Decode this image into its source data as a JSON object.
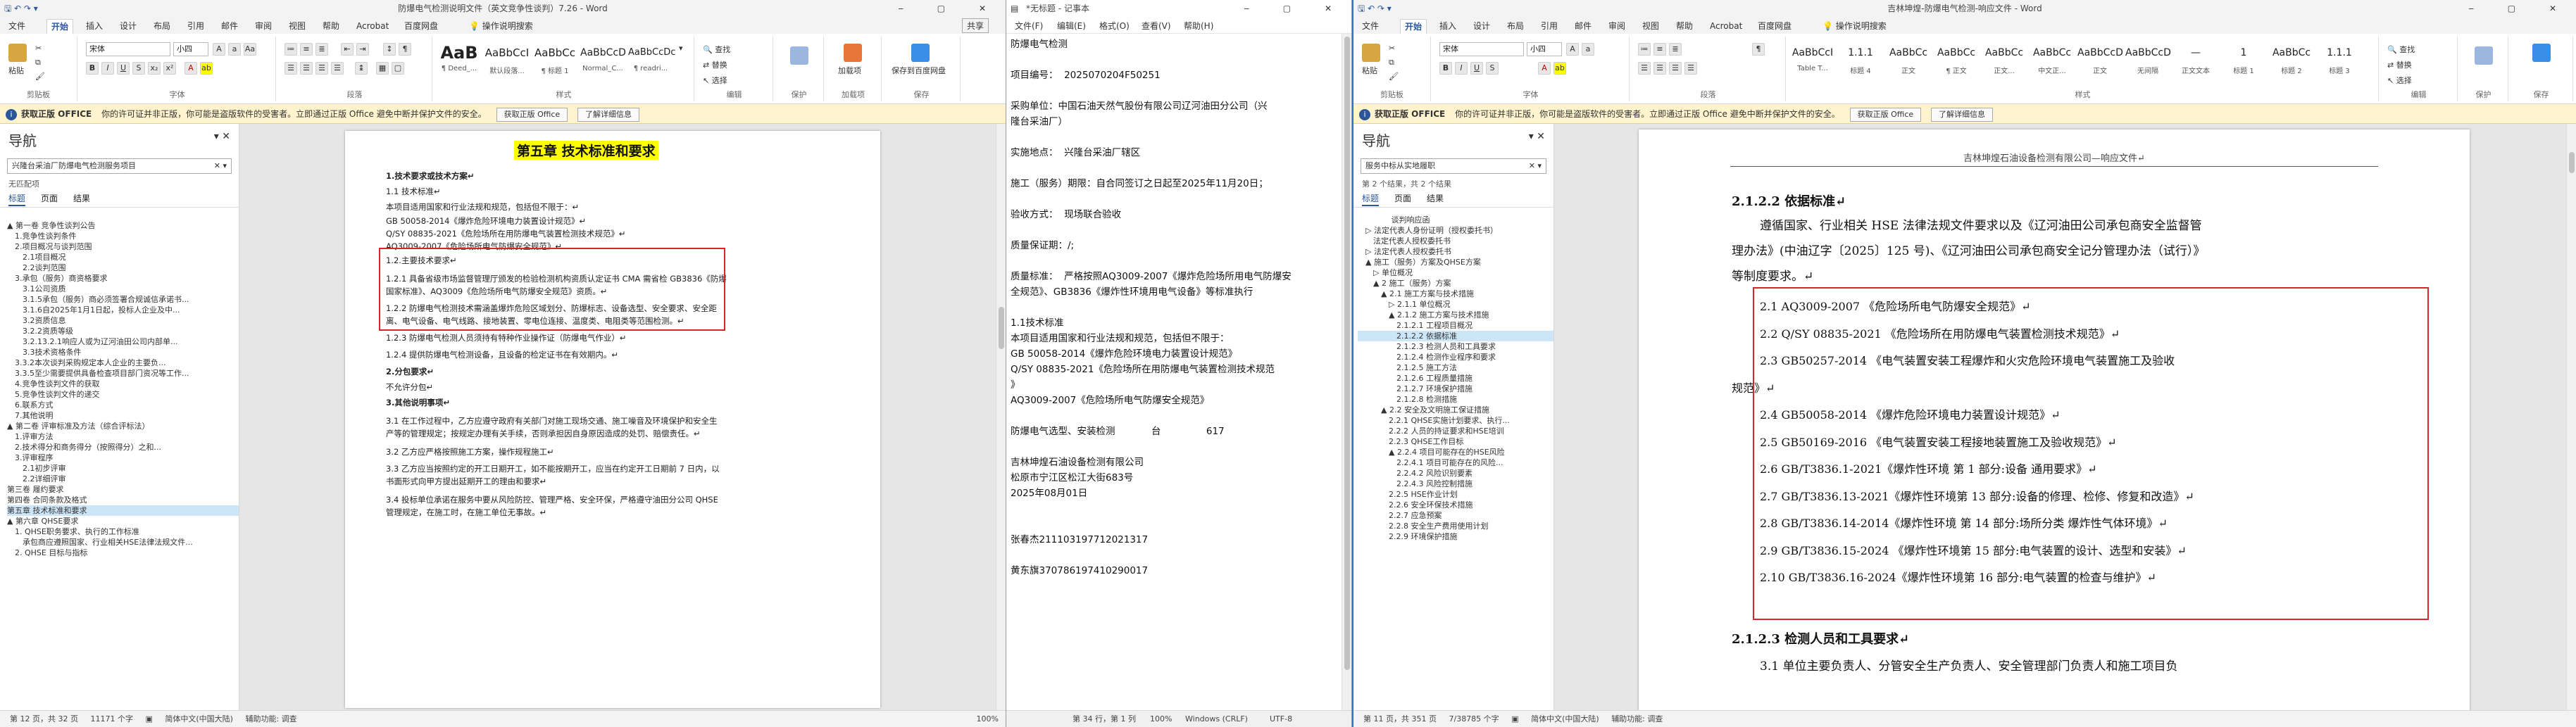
{
  "w1": {
    "title": "防爆电气检测说明文件（英文竞争性谈判）7.26 - Word",
    "menu": [
      "文件",
      "开始",
      "插入",
      "设计",
      "布局",
      "引用",
      "邮件",
      "审阅",
      "视图",
      "帮助",
      "Acrobat",
      "百度网盘",
      "操作说明搜索"
    ],
    "share": "共享",
    "font_name": "宋体",
    "font_size": "小四",
    "clipboard": "剪贴板",
    "font_group": "字体",
    "para_group": "段落",
    "style_group": "样式",
    "edit_group": "编辑",
    "protect_group": "保护",
    "addin_group": "加载项",
    "save_group": "保存",
    "paste": "粘贴",
    "find": "查找",
    "replace": "替换",
    "select": "选择",
    "addin": "加载项",
    "save_to": "保存到百度网盘",
    "styles": [
      {
        "p": "AaB",
        "n": "¶ Deed_..."
      },
      {
        "p": "AaBbCcI",
        "n": "默认段落..."
      },
      {
        "p": "AaBbCc",
        "n": "¶ 标题 1"
      },
      {
        "p": "AaBbCcD",
        "n": "Normal_C..."
      },
      {
        "p": "AaBbCcDc",
        "n": "¶ readri..."
      }
    ],
    "info": {
      "label": "获取正版 OFFICE",
      "text": "你的许可证并非正版，你可能是盗版软件的受害者。立即通过正版 Office 避免中断并保护文件的安全。",
      "btn1": "获取正版 Office",
      "btn2": "了解详细信息"
    },
    "nav": {
      "title": "导航",
      "search": "兴隆台采油厂防爆电气检测服务项目",
      "sub": "无匹配项",
      "tabs": [
        "标题",
        "页面",
        "结果"
      ],
      "items": [
        "▲ 第一卷 竞争性谈判公告",
        "　1.竞争性谈判条件",
        "　2.项目概况与谈判范围",
        "　　2.1项目概况",
        "　　2.2谈判范围",
        "　3.承包（服务）商资格要求",
        "　　3.1公司资质",
        "　　3.1.5承包（服务）商必须签署合规诚信承诺书...",
        "　　3.1.6自2025年1月1日起，投标人企业及中...",
        "　　3.2资质信息",
        "　　3.2.2资质等级",
        "　　3.2.13.2.1响应人或为辽河油田公司内部单...",
        "　　3.3技术资格条件",
        "　3.3.2本次谈判采购规定本人企业的主要负...",
        "　3.3.5至少需要提供具备检查项目部门资况等工作...",
        "　4.竞争性谈判文件的获取",
        "　5.竞争性谈判文件的递交",
        "　6.联系方式",
        "　7.其他说明",
        "▲ 第二卷 评审标准及方法（综合评标法）",
        "　1.评审方法",
        "　2.技术得分和商务得分（按照得分）之和...",
        "　3.评审程序",
        "　　2.1初步评审",
        "　　2.2详细评审",
        "第三卷 履约要求",
        "第四卷 合同条款及格式",
        "第五章 技术标准和要求",
        "▲ 第六章 QHSE要求",
        "　1. QHSE职务要求、执行的工作标准",
        "　　承包商应遵照国家、行业相关HSE法律法规文件...",
        "　2. QHSE 目标与指标"
      ],
      "selected": 27
    },
    "doc": {
      "heading": "第五章  技术标准和要求",
      "lines": [
        "1.技术要求或技术方案↵",
        "1.1 技术标准↵",
        "本项目适用国家和行业法规和规范，包括但不限于：↵",
        "GB 50058-2014《爆炸危险环境电力装置设计规范》↵",
        "Q/SY 08835-2021《危险场所在用防爆电气装置检测技术规范》↵",
        "AQ3009-2007《危险场所电气防爆安全规范》↵",
        "1.2.主要技术要求↵",
        "1.2.1 具备省级市场监督管理厅颁发的检验检测机构资质认定证书 CMA 需省检 GB3836《防爆",
        "国家标准》、AQ3009《危险场所电气防爆安全规范》资质。↵",
        "1.2.2 防爆电气检测技术需涵盖爆炸危险区域划分、防爆标志、设备选型、安全要求、安全距",
        "离、电气设备、电气线路、接地装置、零电位连接、温度类、电阻类等范围检测。↵",
        "1.2.3 防爆电气检测人员须持有特种作业操作证（防爆电气作业）↵",
        "1.2.4 提供防爆电气检测设备，且设备的检定证书在有效期内。↵",
        "2.分包要求↵",
        "不允许分包↵",
        "3.其他说明事项↵",
        "3.1 在工作过程中，乙方应遵守政府有关部门对施工现场交通、施工噪音及环境保护和安全生",
        "产等的管理规定；按规定办理有关手续，否则承担因自身原因造成的处罚、赔偿责任。↵",
        "3.2 乙方应严格按照施工方案，操作规程施工↵",
        "3.3 乙方应当按照约定的开工日期开工，如不能按期开工，应当在约定开工日期前 7 日内，以",
        "书面形式向甲方提出延期开工的理由和要求↵",
        "3.4 投标单位承诺在服务中要从风险防控、管理严格、安全环保，严格遵守油田分公司 QHSE",
        "管理规定，在施工时，在施工单位无事故。↵"
      ]
    },
    "status": {
      "page": "第 12 页，共 32 页",
      "words": "11171 个字",
      "lang": "简体中文(中国大陆)",
      "aux": "辅助功能: 调查",
      "zoom": "100%"
    }
  },
  "w2": {
    "title": "*无标题 - 记事本",
    "menu": [
      "文件(F)",
      "编辑(E)",
      "格式(O)",
      "查看(V)",
      "帮助(H)"
    ],
    "lines": [
      "防爆电气检测",
      "",
      "项目编号：  2025070204F50251",
      "",
      "采购单位：中国石油天然气股份有限公司辽河油田分公司（兴",
      "隆台采油厂）",
      "",
      "实施地点：  兴隆台采油厂辖区",
      "",
      "施工（服务）期限：自合同签订之日起至2025年11月20日；",
      "",
      "验收方式：  现场联合验收",
      "",
      "质量保证期：/;",
      "",
      "质量标准：  严格按照AQ3009-2007《爆炸危险场所用电气防爆安",
      "全规范》、GB3836《爆炸性环境用电气设备》等标准执行",
      "",
      "1.1技术标准",
      "本项目适用国家和行业法规和规范，包括但不限于：",
      "GB 50058-2014《爆炸危险环境电力装置设计规范》",
      "Q/SY 08835-2021《危险场所在用防爆电气装置检测技术规范",
      "》",
      "AQ3009-2007《危险场所电气防爆安全规范》",
      "",
      "防爆电气选型、安装检测            台               617",
      "",
      "吉林坤煌石油设备检测有限公司",
      "松原市宁江区松江大街683号",
      "2025年08月01日",
      "",
      "",
      "张春杰211103197712021317",
      "",
      "黄东旗370786197410290017"
    ],
    "status": {
      "pos": "第 34 行，第 1 列",
      "zoom": "100%",
      "eol": "Windows (CRLF)",
      "enc": "UTF-8"
    }
  },
  "w3": {
    "title": "吉林坤煌-防爆电气检测-响应文件 - Word",
    "menu": [
      "文件",
      "开始",
      "插入",
      "设计",
      "布局",
      "引用",
      "邮件",
      "审阅",
      "视图",
      "帮助",
      "Acrobat",
      "百度网盘",
      "操作说明搜索"
    ],
    "font_name": "宋体",
    "font_size": "小四",
    "styles": [
      {
        "p": "AaBbCcI",
        "n": "Table T..."
      },
      {
        "p": "1.1.1",
        "n": "标题 4"
      },
      {
        "p": "AaBbCc",
        "n": "正文"
      },
      {
        "p": "AaBbCc",
        "n": "¶ 正文"
      },
      {
        "p": "AaBbCc",
        "n": "正文..."
      },
      {
        "p": "AaBbCc",
        "n": "中文正..."
      },
      {
        "p": "AaBbCcD",
        "n": "正文"
      },
      {
        "p": "AaBbCcD",
        "n": "无间隔"
      },
      {
        "p": "—",
        "n": "正文文本"
      },
      {
        "p": "1",
        "n": "标题 1"
      },
      {
        "p": "AaBbCc",
        "n": "标题 2"
      },
      {
        "p": "1.1.1",
        "n": "标题 3"
      }
    ],
    "info": {
      "label": "获取正版 OFFICE",
      "text": "你的许可证并非正版，你可能是盗版软件的受害者。立即通过正版 Office 避免中断并保护文件的安全。",
      "btn1": "获取正版 Office",
      "btn2": "了解详细信息"
    },
    "nav": {
      "title": "导航",
      "search": "服务中标从实地履职",
      "sub": "第 2 个结果，共 2 个结果",
      "tabs": [
        "标题",
        "页面",
        "结果"
      ],
      "items": [
        "　　　　 谈判响应函",
        "　▷ 法定代表人身份证明（授权委托书）",
        "　　法定代表人授权委托书",
        "　▷ 法定代表人授权委托书",
        "　▲ 施工（服务）方案及QHSE方案",
        "　　▷ 单位概况",
        "　　▲ 2 施工（服务）方案",
        "　　　▲ 2.1 施工方案与技术措施",
        "　　　　▷ 2.1.1 单位概况",
        "　　　　▲ 2.1.2 施工方案与技术措施",
        "　　　　　2.1.2.1 工程项目概况",
        "　　　　　2.1.2.2 依据标准",
        "　　　　　2.1.2.3 检测人员和工具要求",
        "　　　　　2.1.2.4 检测作业程序和要求",
        "　　　　　2.1.2.5 施工方法",
        "　　　　　2.1.2.6 工程质量措施",
        "　　　　　2.1.2.7 环境保护措施",
        "　　　　　2.1.2.8 检测措施",
        "　　　▲ 2.2 安全及文明施工保证措施",
        "　　　　2.2.1 QHSE实施计划要求、执行...",
        "　　　　2.2.2 人员的持证要求和HSE培训",
        "　　　　2.2.3 QHSE工作目标",
        "　　　　▲ 2.2.4 项目可能存在的HSE风险",
        "　　　　　2.2.4.1 项目可能存在的风险...",
        "　　　　　2.2.4.2 风险识别要素",
        "　　　　　2.2.4.3 风险控制措施",
        "　　　　2.2.5 HSE作业计划",
        "　　　　2.2.6 安全环保技术措施",
        "　　　　2.2.7 应急预案",
        "　　　　2.2.8 安全生产费用使用计划",
        "　　　　2.2.9 环境保护措施"
      ],
      "selected": 11
    },
    "doc": {
      "header": "吉林坤煌石油设备检测有限公司—响应文件↵",
      "h1": "2.1.2.2    依据标准↵",
      "intro": [
        "遵循国家、行业相关 HSE 法律法规文件要求以及《辽河油田公司承包商安全监督管",
        "理办法》(中油辽字〔2025〕125 号)、《辽河油田公司承包商安全记分管理办法（试行）》",
        "等制度要求。↵"
      ],
      "items": [
        "2.1 AQ3009-2007 《危险场所电气防爆安全规范》↵",
        "2.2 Q/SY 08835-2021 《危险场所在用防爆电气装置检测技术规范》↵",
        "2.3 GB50257-2014 《电气装置安装工程爆炸和火灾危险环境电气装置施工及验收",
        "规范》↵",
        "2.4 GB50058-2014 《爆炸危险环境电力装置设计规范》↵",
        "2.5 GB50169-2016 《电气装置安装工程接地装置施工及验收规范》↵",
        "2.6 GB/T3836.1-2021《爆炸性环境 第 1 部分:设备 通用要求》↵",
        "2.7 GB/T3836.13-2021《爆炸性环境第 13 部分:设备的修理、检修、修复和改造》↵",
        "2.8 GB/T3836.14-2014《爆炸性环境 第 14 部分:场所分类 爆炸性气体环境》↵",
        "2.9 GB/T3836.15-2024 《爆炸性环境第 15 部分:电气装置的设计、选型和安装》↵",
        "2.10 GB/T3836.16-2024《爆炸性环境第 16 部分:电气装置的检查与维护》↵"
      ],
      "h2": "2.1.2.3    检测人员和工具要求↵",
      "tail": "3.1 单位主要负责人、分管安全生产负责人、安全管理部门负责人和施工项目负"
    },
    "status": {
      "page": "第 11 页，共 351 页",
      "words": "7/38785 个字",
      "lang": "简体中文(中国大陆)",
      "aux": "辅助功能: 调查"
    }
  }
}
